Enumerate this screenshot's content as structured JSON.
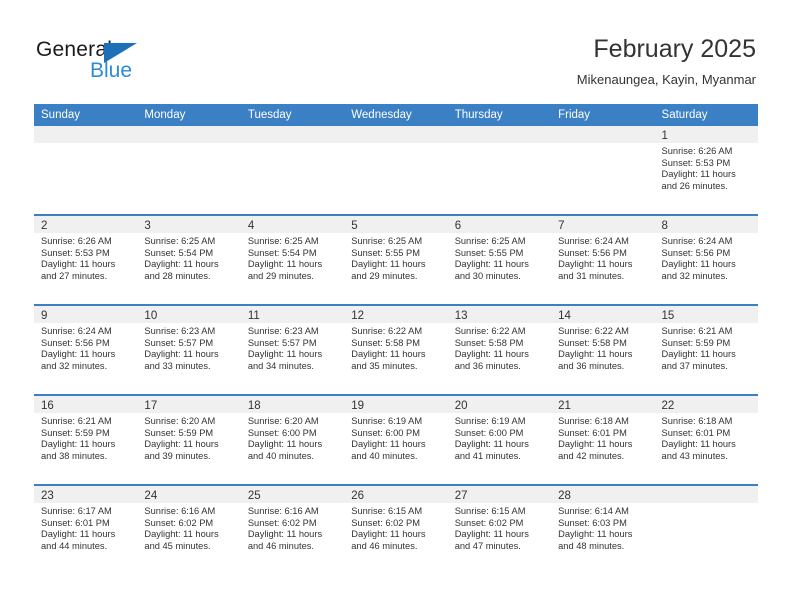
{
  "brand": {
    "name_top": "General",
    "name_bottom": "Blue",
    "accent_color": "#2e8bd6",
    "triangle_color": "#1c70b8"
  },
  "header": {
    "title": "February 2025",
    "subtitle": "Mikenaungea, Kayin, Myanmar"
  },
  "calendar": {
    "header_bg": "#3b7fc4",
    "daynum_band_bg": "#f0f0f0",
    "weekdays": [
      "Sunday",
      "Monday",
      "Tuesday",
      "Wednesday",
      "Thursday",
      "Friday",
      "Saturday"
    ],
    "weeks": [
      [
        {
          "empty": true
        },
        {
          "empty": true
        },
        {
          "empty": true
        },
        {
          "empty": true
        },
        {
          "empty": true
        },
        {
          "empty": true
        },
        {
          "day": "1",
          "sunrise": "Sunrise: 6:26 AM",
          "sunset": "Sunset: 5:53 PM",
          "daylight": "Daylight: 11 hours and 26 minutes."
        }
      ],
      [
        {
          "day": "2",
          "sunrise": "Sunrise: 6:26 AM",
          "sunset": "Sunset: 5:53 PM",
          "daylight": "Daylight: 11 hours and 27 minutes."
        },
        {
          "day": "3",
          "sunrise": "Sunrise: 6:25 AM",
          "sunset": "Sunset: 5:54 PM",
          "daylight": "Daylight: 11 hours and 28 minutes."
        },
        {
          "day": "4",
          "sunrise": "Sunrise: 6:25 AM",
          "sunset": "Sunset: 5:54 PM",
          "daylight": "Daylight: 11 hours and 29 minutes."
        },
        {
          "day": "5",
          "sunrise": "Sunrise: 6:25 AM",
          "sunset": "Sunset: 5:55 PM",
          "daylight": "Daylight: 11 hours and 29 minutes."
        },
        {
          "day": "6",
          "sunrise": "Sunrise: 6:25 AM",
          "sunset": "Sunset: 5:55 PM",
          "daylight": "Daylight: 11 hours and 30 minutes."
        },
        {
          "day": "7",
          "sunrise": "Sunrise: 6:24 AM",
          "sunset": "Sunset: 5:56 PM",
          "daylight": "Daylight: 11 hours and 31 minutes."
        },
        {
          "day": "8",
          "sunrise": "Sunrise: 6:24 AM",
          "sunset": "Sunset: 5:56 PM",
          "daylight": "Daylight: 11 hours and 32 minutes."
        }
      ],
      [
        {
          "day": "9",
          "sunrise": "Sunrise: 6:24 AM",
          "sunset": "Sunset: 5:56 PM",
          "daylight": "Daylight: 11 hours and 32 minutes."
        },
        {
          "day": "10",
          "sunrise": "Sunrise: 6:23 AM",
          "sunset": "Sunset: 5:57 PM",
          "daylight": "Daylight: 11 hours and 33 minutes."
        },
        {
          "day": "11",
          "sunrise": "Sunrise: 6:23 AM",
          "sunset": "Sunset: 5:57 PM",
          "daylight": "Daylight: 11 hours and 34 minutes."
        },
        {
          "day": "12",
          "sunrise": "Sunrise: 6:22 AM",
          "sunset": "Sunset: 5:58 PM",
          "daylight": "Daylight: 11 hours and 35 minutes."
        },
        {
          "day": "13",
          "sunrise": "Sunrise: 6:22 AM",
          "sunset": "Sunset: 5:58 PM",
          "daylight": "Daylight: 11 hours and 36 minutes."
        },
        {
          "day": "14",
          "sunrise": "Sunrise: 6:22 AM",
          "sunset": "Sunset: 5:58 PM",
          "daylight": "Daylight: 11 hours and 36 minutes."
        },
        {
          "day": "15",
          "sunrise": "Sunrise: 6:21 AM",
          "sunset": "Sunset: 5:59 PM",
          "daylight": "Daylight: 11 hours and 37 minutes."
        }
      ],
      [
        {
          "day": "16",
          "sunrise": "Sunrise: 6:21 AM",
          "sunset": "Sunset: 5:59 PM",
          "daylight": "Daylight: 11 hours and 38 minutes."
        },
        {
          "day": "17",
          "sunrise": "Sunrise: 6:20 AM",
          "sunset": "Sunset: 5:59 PM",
          "daylight": "Daylight: 11 hours and 39 minutes."
        },
        {
          "day": "18",
          "sunrise": "Sunrise: 6:20 AM",
          "sunset": "Sunset: 6:00 PM",
          "daylight": "Daylight: 11 hours and 40 minutes."
        },
        {
          "day": "19",
          "sunrise": "Sunrise: 6:19 AM",
          "sunset": "Sunset: 6:00 PM",
          "daylight": "Daylight: 11 hours and 40 minutes."
        },
        {
          "day": "20",
          "sunrise": "Sunrise: 6:19 AM",
          "sunset": "Sunset: 6:00 PM",
          "daylight": "Daylight: 11 hours and 41 minutes."
        },
        {
          "day": "21",
          "sunrise": "Sunrise: 6:18 AM",
          "sunset": "Sunset: 6:01 PM",
          "daylight": "Daylight: 11 hours and 42 minutes."
        },
        {
          "day": "22",
          "sunrise": "Sunrise: 6:18 AM",
          "sunset": "Sunset: 6:01 PM",
          "daylight": "Daylight: 11 hours and 43 minutes."
        }
      ],
      [
        {
          "day": "23",
          "sunrise": "Sunrise: 6:17 AM",
          "sunset": "Sunset: 6:01 PM",
          "daylight": "Daylight: 11 hours and 44 minutes."
        },
        {
          "day": "24",
          "sunrise": "Sunrise: 6:16 AM",
          "sunset": "Sunset: 6:02 PM",
          "daylight": "Daylight: 11 hours and 45 minutes."
        },
        {
          "day": "25",
          "sunrise": "Sunrise: 6:16 AM",
          "sunset": "Sunset: 6:02 PM",
          "daylight": "Daylight: 11 hours and 46 minutes."
        },
        {
          "day": "26",
          "sunrise": "Sunrise: 6:15 AM",
          "sunset": "Sunset: 6:02 PM",
          "daylight": "Daylight: 11 hours and 46 minutes."
        },
        {
          "day": "27",
          "sunrise": "Sunrise: 6:15 AM",
          "sunset": "Sunset: 6:02 PM",
          "daylight": "Daylight: 11 hours and 47 minutes."
        },
        {
          "day": "28",
          "sunrise": "Sunrise: 6:14 AM",
          "sunset": "Sunset: 6:03 PM",
          "daylight": "Daylight: 11 hours and 48 minutes."
        },
        {
          "empty": true
        }
      ]
    ]
  }
}
